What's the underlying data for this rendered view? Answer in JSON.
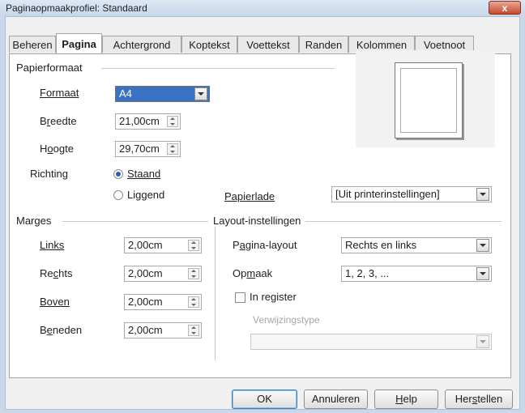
{
  "window": {
    "title": "Paginaopmaakprofiel: Standaard",
    "close_label": "x"
  },
  "tabs": [
    {
      "label": "Beheren",
      "active": false
    },
    {
      "label": "Pagina",
      "active": true
    },
    {
      "label": "Achtergrond",
      "active": false
    },
    {
      "label": "Koptekst",
      "active": false
    },
    {
      "label": "Voettekst",
      "active": false
    },
    {
      "label": "Randen",
      "active": false
    },
    {
      "label": "Kolommen",
      "active": false
    },
    {
      "label": "Voetnoot",
      "active": false
    }
  ],
  "paper": {
    "section_label": "Papierformaat",
    "format_label": "Formaat",
    "format_value": "A4",
    "width_label": "Breedte",
    "width_value": "21,00cm",
    "height_label": "Hoogte",
    "height_value": "29,70cm",
    "orientation_label": "Richting",
    "portrait_label": "Staand",
    "landscape_label": "Liggend",
    "orientation_selected": "Staand",
    "tray_label": "Papierlade",
    "tray_value": "[Uit printerinstellingen]"
  },
  "margins": {
    "section_label": "Marges",
    "left_label": "Links",
    "left_value": "2,00cm",
    "right_label": "Rechts",
    "right_value": "2,00cm",
    "top_label": "Boven",
    "top_value": "2,00cm",
    "bottom_label": "Beneden",
    "bottom_value": "2,00cm"
  },
  "layout": {
    "section_label": "Layout-instellingen",
    "page_layout_label": "Pagina-layout",
    "page_layout_value": "Rechts en links",
    "format_label": "Opmaak",
    "format_value": "1, 2, 3, ...",
    "register_label": "In register",
    "register_checked": false,
    "reference_style_label": "Verwijzingstype",
    "reference_style_value": ""
  },
  "buttons": {
    "ok": "OK",
    "cancel": "Annuleren",
    "help": "Help",
    "reset": "Herstellen"
  },
  "colors": {
    "selection": "#3a72c4",
    "accent": "#2e5fb0"
  }
}
